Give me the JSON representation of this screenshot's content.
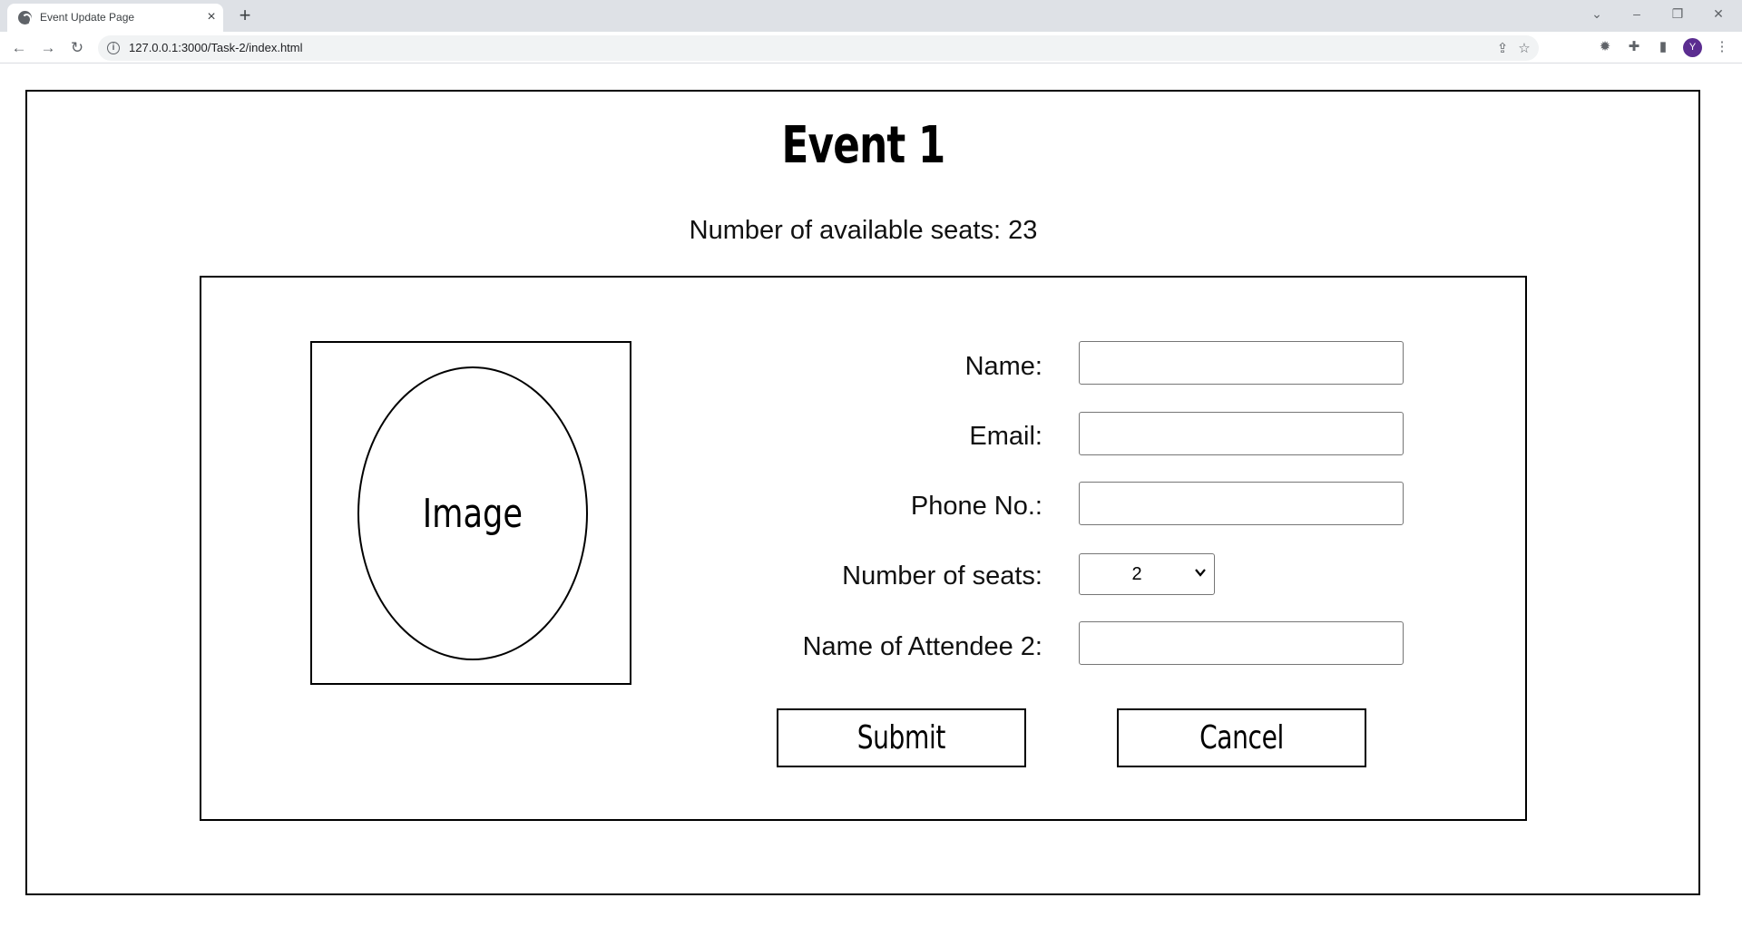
{
  "browser": {
    "tab_title": "Event Update Page",
    "tab_close": "×",
    "new_tab": "+",
    "url": "127.0.0.1:3000/Task-2/index.html",
    "profile_initial": "Y"
  },
  "page": {
    "title": "Event 1",
    "seats_available": "Number of available seats: 23",
    "image_placeholder": "Image"
  },
  "form": {
    "name_label": "Name:",
    "email_label": "Email:",
    "phone_label": "Phone No.:",
    "seats_label": "Number of seats:",
    "seats_value": "2",
    "attendee_label": "Name of Attendee 2:",
    "name_value": "",
    "email_value": "",
    "phone_value": "",
    "attendee_value": ""
  },
  "buttons": {
    "submit": "Submit",
    "cancel": "Cancel"
  }
}
